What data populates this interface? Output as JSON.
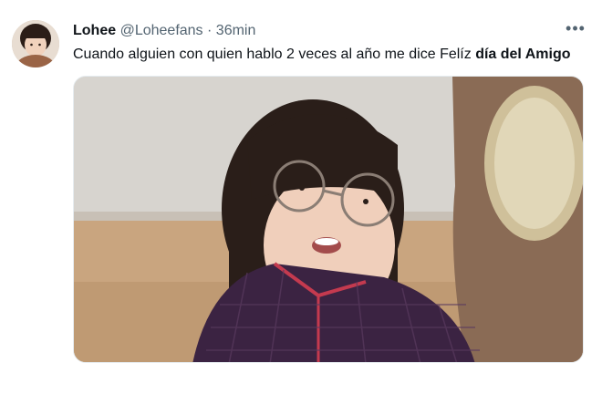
{
  "tweet": {
    "author_name": "Lohee",
    "author_handle": "@Loheefans",
    "separator": "·",
    "time": "36min",
    "text_plain": "Cuando alguien con quien hablo 2 veces al año me dice Felíz ",
    "text_bold": "día del Amigo",
    "more_icon": "more-horizontal-icon",
    "avatar_icon": "avatar",
    "media": "photo of young girl with round glasses"
  },
  "colors": {
    "name": "#0f1419",
    "secondary": "#536471",
    "border": "#e6ecf0"
  }
}
